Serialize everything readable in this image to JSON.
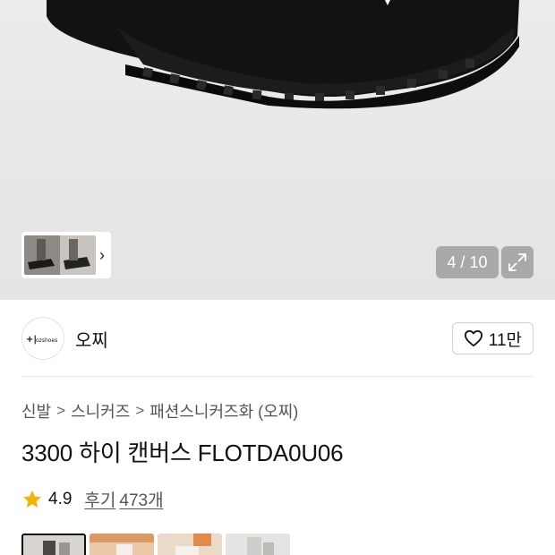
{
  "gallery": {
    "counter": "4 / 10",
    "thumb_strip_arrow": "›"
  },
  "brand": {
    "name": "오찌",
    "logo_text": "ozshoes",
    "like_count": "11만"
  },
  "breadcrumb": {
    "items": [
      "신발",
      "스니커즈",
      "패션스니커즈화 (오찌)"
    ],
    "separator": ">"
  },
  "product": {
    "title": "3300 하이 캔버스 FLOTDA0U06"
  },
  "rating": {
    "score": "4.9",
    "reviews_label": "후기",
    "reviews_count": "473개"
  },
  "colors": {
    "accent_star": "#f5b301",
    "text_primary": "#111111",
    "text_secondary": "#555555"
  },
  "icons": {
    "heart": "heart-icon",
    "expand": "expand-icon",
    "star": "star-icon",
    "chevron": "chevron-right-icon"
  }
}
